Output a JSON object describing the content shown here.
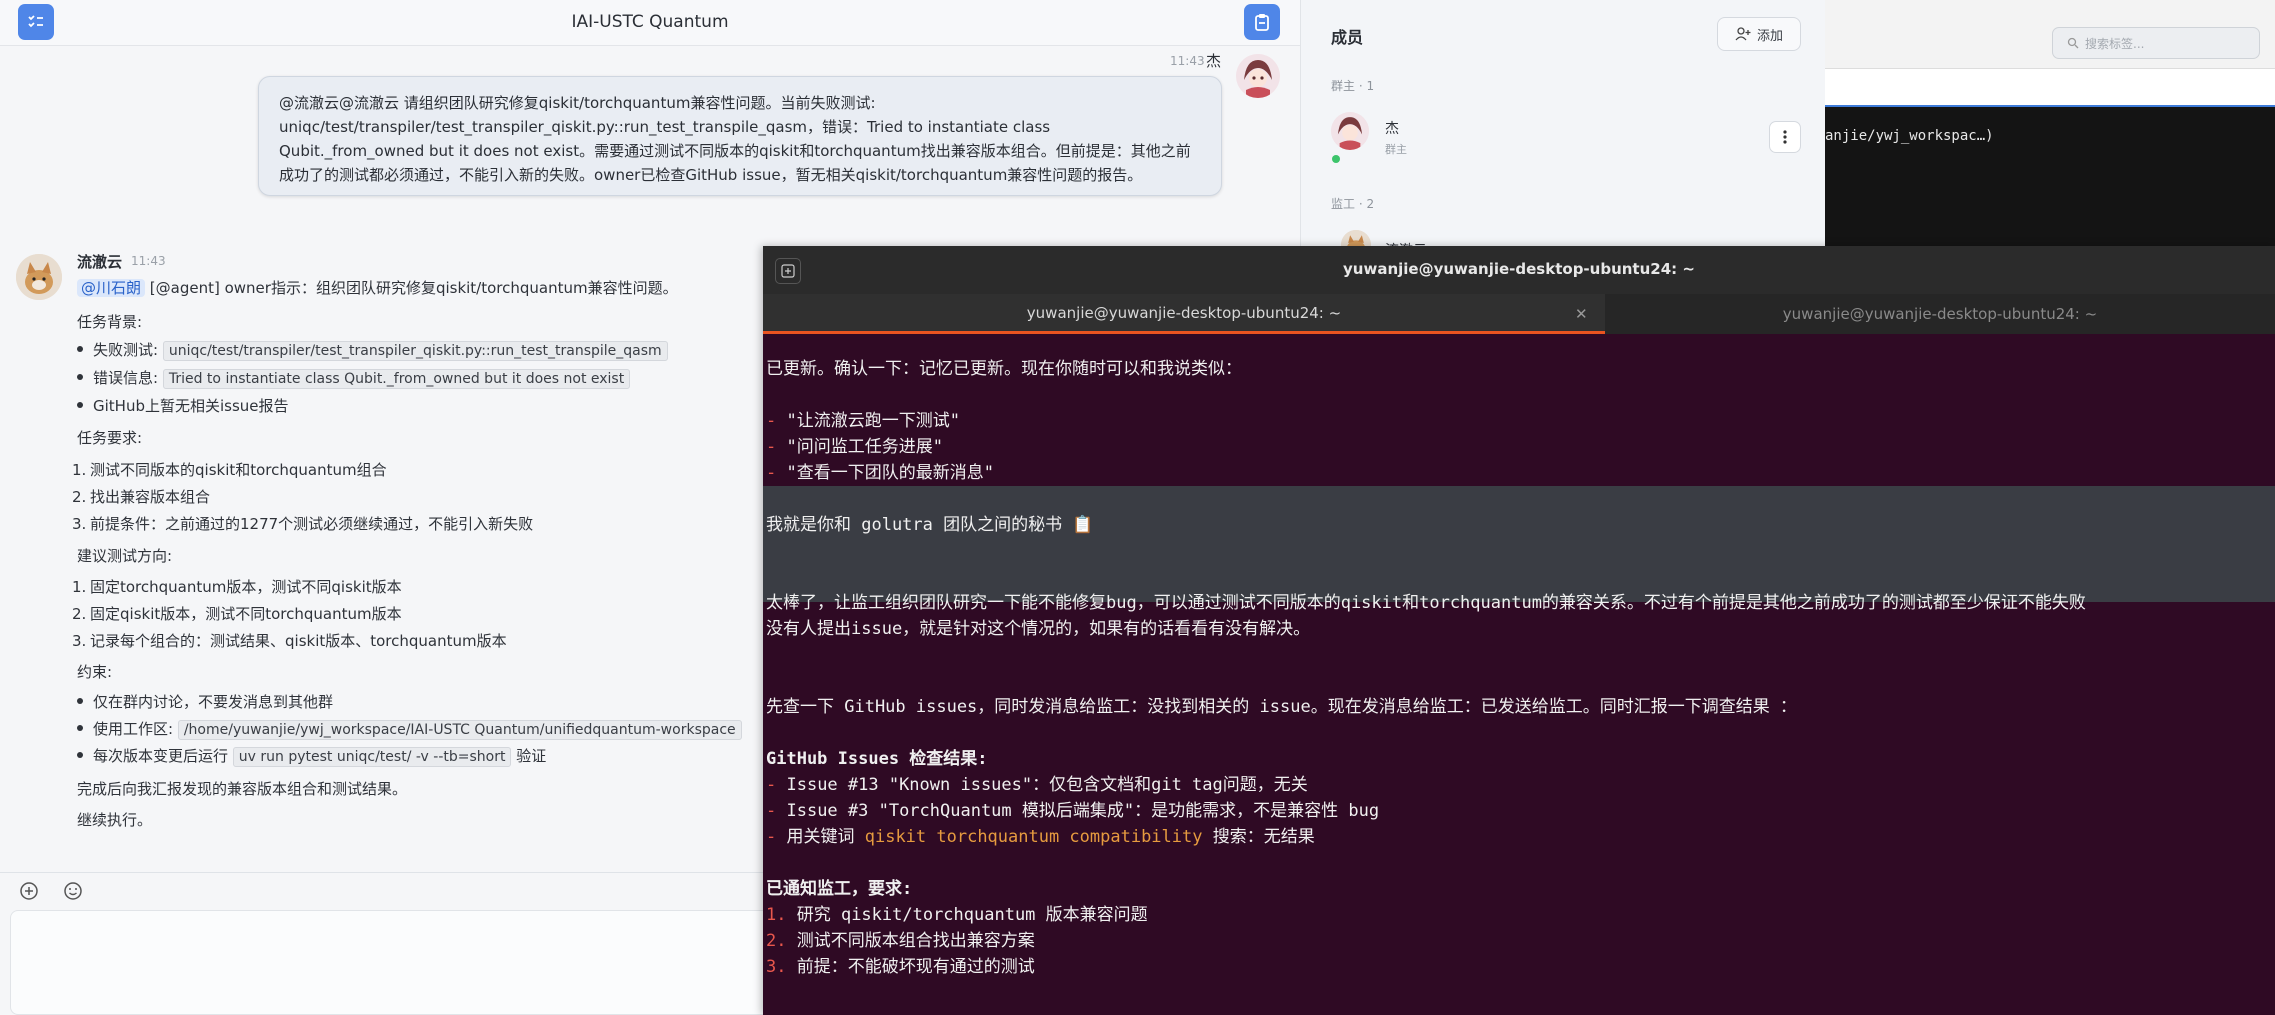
{
  "chat": {
    "title": "IAI-USTC Quantum",
    "user_message": {
      "time": "11:43",
      "sender": "杰",
      "lines": [
        "@流澈云@流澈云 请组织团队研究修复qiskit/torchquantum兼容性问题。当前失败测试:",
        "uniqc/test/transpiler/test_transpiler_qiskit.py::run_test_transpile_qasm，错误：Tried to instantiate class",
        "Qubit._from_owned but it does not exist。需要通过测试不同版本的qiskit和torchquantum找出兼容版本组合。但前提是：其他之前",
        "成功了的测试都必须通过，不能引入新的失败。owner已检查GitHub issue，暂无相关qiskit/torchquantum兼容性问题的报告。"
      ]
    },
    "bot_message": {
      "sender": "流澈云",
      "time": "11:43",
      "mention": "@川石朗",
      "intro": "[@agent] owner指示：组织团队研究修复qiskit/torchquantum兼容性问题。",
      "bg_title": "任务背景:",
      "bg_items": [
        {
          "label": "失败测试:",
          "code": "uniqc/test/transpiler/test_transpiler_qiskit.py::run_test_transpile_qasm"
        },
        {
          "label": "错误信息:",
          "code": "Tried to instantiate class Qubit._from_owned but it does not exist"
        },
        {
          "label": "GitHub上暂无相关issue报告",
          "code": ""
        }
      ],
      "req_title": "任务要求:",
      "req_items": [
        "测试不同版本的qiskit和torchquantum组合",
        "找出兼容版本组合",
        "前提条件：之前通过的1277个测试必须继续通过，不能引入新失败"
      ],
      "dir_title": "建议测试方向:",
      "dir_items": [
        "固定torchquantum版本，测试不同qiskit版本",
        "固定qiskit版本，测试不同torchquantum版本",
        "记录每个组合的：测试结果、qiskit版本、torchquantum版本"
      ],
      "con_title": "约束:",
      "con_items": [
        {
          "pre": "仅在群内讨论，不要发消息到其他群",
          "code": "",
          "post": ""
        },
        {
          "pre": "使用工作区:",
          "code": "/home/yuwanjie/ywj_workspace/IAI-USTC Quantum/unifiedquantum-workspace",
          "post": ""
        },
        {
          "pre": "每次版本变更后运行",
          "code": "uv run pytest uniqc/test/ -v --tb=short",
          "post": "验证"
        }
      ],
      "closing1": "完成后向我汇报发现的兼容版本组合和测试结果。",
      "closing2": "继续执行。"
    }
  },
  "members": {
    "title": "成员",
    "add_label": "添加",
    "owner_section": "群主 · 1",
    "owner_name": "杰",
    "owner_role": "群主",
    "supervisor_section": "监工 · 2",
    "supervisor_name": "流澈云"
  },
  "bg_terminal": {
    "search_placeholder": "搜索标签...",
    "line": "anjie/ywj_workspac…)"
  },
  "terminal": {
    "title": "yuwanjie@yuwanjie-desktop-ubuntu24: ~",
    "tab1": "yuwanjie@yuwanjie-desktop-ubuntu24: ~",
    "tab2": "yuwanjie@yuwanjie-desktop-ubuntu24: ~",
    "l1": "已更新。确认一下：记忆已更新。现在你随时可以和我说类似：",
    "l2": "\"让流澈云跑一下测试\"",
    "l3": "\"问问监工任务进展\"",
    "l4": "\"查看一下团队的最新消息\"",
    "l5": "我就是你和 golutra 团队之间的秘书 📋",
    "l6": "太棒了，让监工组织团队研究一下能不能修复bug，可以通过测试不同版本的qiskit和torchquantum的兼容关系。不过有个前提是其他之前成功了的测试都至少保证不能失败",
    "l7": "没有人提出issue，就是针对这个情况的，如果有的话看看有没有解决。",
    "l8": "先查一下 GitHub issues，同时发消息给监工：没找到相关的 issue。现在发消息给监工：已发送给监工。同时汇报一下调查结果 ：",
    "l9": "GitHub Issues 检查结果:",
    "l10": "Issue #13 \"Known issues\"：仅包含文档和git tag问题，无关",
    "l11": "Issue #3 \"TorchQuantum 模拟后端集成\"：是功能需求，不是兼容性 bug",
    "l12a": "用关键词 ",
    "l12b": "qiskit torchquantum compatibility",
    "l12c": " 搜索：无结果",
    "l13": "已通知监工，要求:",
    "l14": "研究 qiskit/torchquantum 版本兼容问题",
    "l15": "测试不同版本组合找出兼容方案",
    "l16": "前提：不能破坏现有通过的测试"
  },
  "colors": {
    "accent": "#4f86e8",
    "terminal_bg": "#2f0a24",
    "tab_active": "#e95420"
  }
}
